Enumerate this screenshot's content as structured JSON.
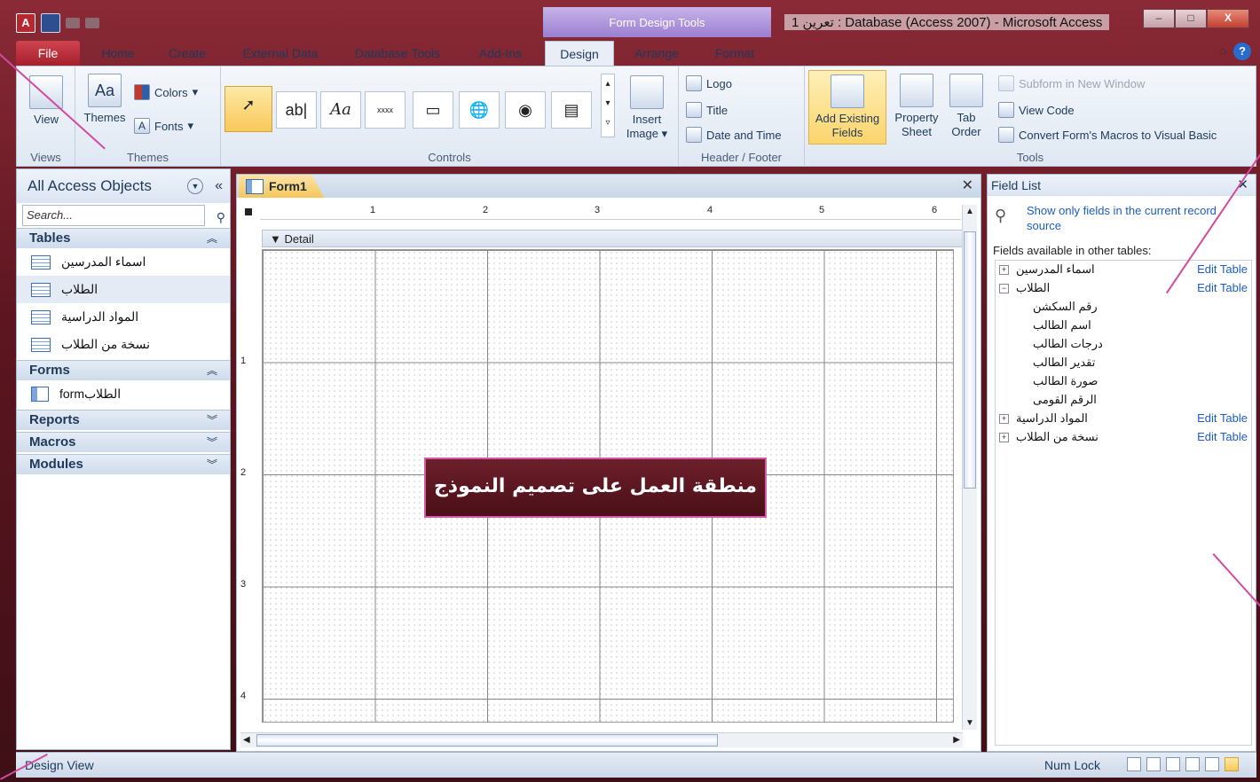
{
  "window": {
    "contextual_label": "Form Design Tools",
    "title": "تعرين 1 : Database (Access 2007)  -  Microsoft Access",
    "minimize": "–",
    "maximize": "□",
    "close": "X",
    "app_icon": "A"
  },
  "tabs": [
    "File",
    "Home",
    "Create",
    "External Data",
    "Database Tools",
    "Add-Ins",
    "Design",
    "Arrange",
    "Format"
  ],
  "active_tab": "Design",
  "ribbon": {
    "views": {
      "view_label": "View",
      "group": "Views"
    },
    "themes": {
      "themes_label": "Themes",
      "colors_label": "Colors",
      "fonts_label": "Fonts",
      "group": "Themes"
    },
    "controls": {
      "group": "Controls",
      "textbox": "ab|",
      "label": "Aa",
      "button": "xxxx",
      "insert_image": "Insert\nImage"
    },
    "header_footer": {
      "logo": "Logo",
      "title": "Title",
      "date_time": "Date and Time",
      "group": "Header / Footer"
    },
    "tools": {
      "add_existing": "Add Existing Fields",
      "property_sheet": "Property Sheet",
      "tab_order": "Tab Order",
      "subform": "Subform in New Window",
      "view_code": "View Code",
      "convert": "Convert Form's Macros to Visual Basic",
      "group": "Tools"
    }
  },
  "nav": {
    "header": "All Access Objects",
    "search_placeholder": "Search...",
    "sections": {
      "tables": {
        "label": "Tables",
        "items": [
          "اسماء المدرسين",
          "الطلاب",
          "المواد الدراسية",
          "نسخة من الطلاب"
        ]
      },
      "forms": {
        "label": "Forms",
        "items": [
          "formالطلاب"
        ]
      },
      "reports": "Reports",
      "macros": "Macros",
      "modules": "Modules"
    }
  },
  "document": {
    "tab_label": "Form1",
    "detail_label": "Detail",
    "ruler_numbers": [
      "1",
      "2",
      "3",
      "4",
      "5",
      "6"
    ],
    "vruler_numbers": [
      "1",
      "2",
      "3",
      "4"
    ],
    "callout": "منطقة العمل على تصميم النموذج"
  },
  "field_list": {
    "title": "Field List",
    "show_only": "Show only fields in the current record source",
    "available": "Fields available in other tables:",
    "edit_label": "Edit Table",
    "tables": [
      {
        "name": "اسماء المدرسين",
        "expanded": false
      },
      {
        "name": "الطلاب",
        "expanded": true
      },
      {
        "name": "المواد الدراسية",
        "expanded": false
      },
      {
        "name": "نسخة من الطلاب",
        "expanded": false
      }
    ],
    "fields": [
      "رقم السكشن",
      "اسم الطالب",
      "درجات الطالب",
      "تقدير الطالب",
      "صورة الطالب",
      "الرقم القومى"
    ]
  },
  "status": {
    "left": "Design View",
    "num_lock": "Num Lock"
  }
}
